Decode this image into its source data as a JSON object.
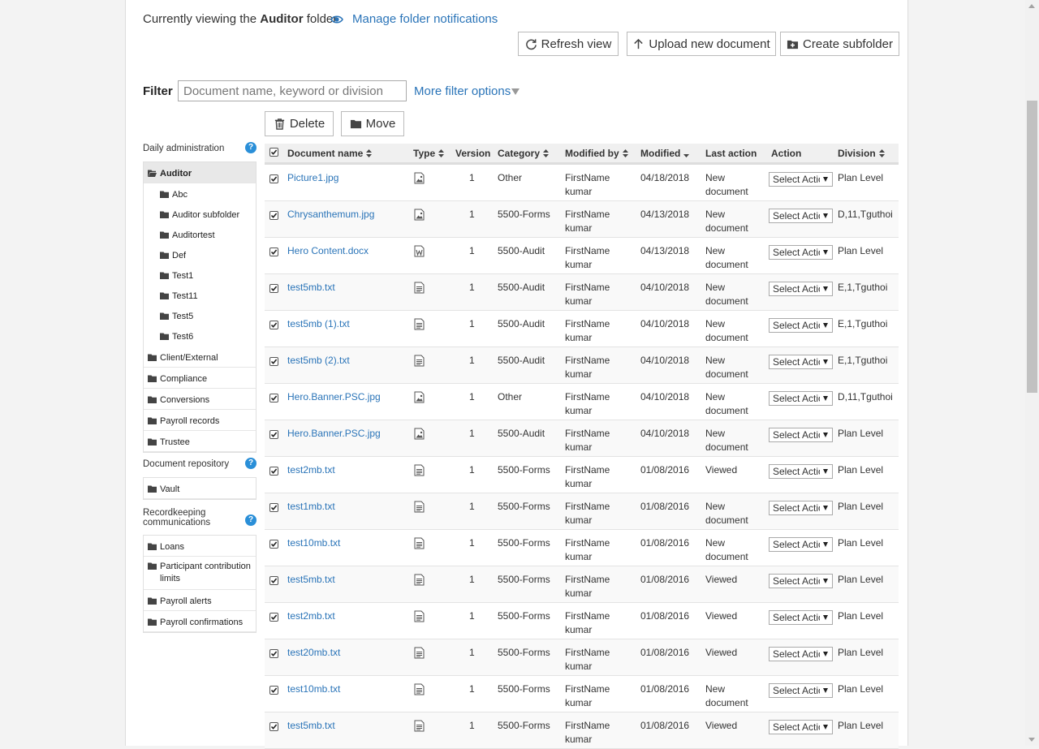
{
  "header": {
    "viewing_prefix": "Currently viewing the",
    "folder_name": "Auditor",
    "viewing_suffix": "folder",
    "manage_link": "Manage folder notifications"
  },
  "toolbar": {
    "refresh": "Refresh view",
    "upload": "Upload new document",
    "create_subfolder": "Create subfolder",
    "delete": "Delete",
    "move": "Move"
  },
  "filter": {
    "label": "Filter",
    "placeholder": "Document name, keyword or division",
    "more_options": "More filter options"
  },
  "sidebar": {
    "daily_admin": {
      "heading": "Daily administration",
      "items": [
        {
          "label": "Auditor",
          "active": true,
          "sub": false
        },
        {
          "label": "Abc",
          "sub": true
        },
        {
          "label": "Auditor subfolder",
          "sub": true
        },
        {
          "label": "Auditortest",
          "sub": true
        },
        {
          "label": "Def",
          "sub": true
        },
        {
          "label": "Test1",
          "sub": true
        },
        {
          "label": "Test11",
          "sub": true
        },
        {
          "label": "Test5",
          "sub": true
        },
        {
          "label": "Test6",
          "sub": true
        },
        {
          "label": "Client/External",
          "sub": false
        },
        {
          "label": "Compliance",
          "sub": false
        },
        {
          "label": "Conversions",
          "sub": false
        },
        {
          "label": "Payroll records",
          "sub": false
        },
        {
          "label": "Trustee",
          "sub": false
        }
      ]
    },
    "doc_repo": {
      "heading": "Document repository",
      "items": [
        {
          "label": "Vault"
        }
      ]
    },
    "recordkeeping": {
      "heading": "Recordkeeping communications",
      "items": [
        {
          "label": "Loans"
        },
        {
          "label": "Participant contribution limits"
        },
        {
          "label": "Payroll alerts"
        },
        {
          "label": "Payroll confirmations"
        }
      ]
    },
    "help_glyph": "?"
  },
  "table": {
    "columns": {
      "name": "Document name",
      "type": "Type",
      "version": "Version",
      "category": "Category",
      "modified_by": "Modified by",
      "modified": "Modified",
      "last_action": "Last action",
      "action": "Action",
      "division": "Division"
    },
    "select_placeholder": "Select Action",
    "rows": [
      {
        "name": "Picture1.jpg",
        "type": "image",
        "version": "1",
        "category": "Other",
        "by1": "FirstName",
        "by2": "kumar",
        "date": "04/18/2018",
        "act1": "New",
        "act2": "document",
        "division": "Plan Level"
      },
      {
        "name": "Chrysanthemum.jpg",
        "type": "image",
        "version": "1",
        "category": "5500-Forms",
        "by1": "FirstName",
        "by2": "kumar",
        "date": "04/13/2018",
        "act1": "New",
        "act2": "document",
        "division": "D,11,Tguthoi"
      },
      {
        "name": "Hero Content.docx",
        "type": "word",
        "version": "1",
        "category": "5500-Audit",
        "by1": "FirstName",
        "by2": "kumar",
        "date": "04/13/2018",
        "act1": "New",
        "act2": "document",
        "division": "Plan Level"
      },
      {
        "name": "test5mb.txt",
        "type": "text",
        "version": "1",
        "category": "5500-Audit",
        "by1": "FirstName",
        "by2": "kumar",
        "date": "04/10/2018",
        "act1": "New",
        "act2": "document",
        "division": "E,1,Tguthoi"
      },
      {
        "name": "test5mb (1).txt",
        "type": "text",
        "version": "1",
        "category": "5500-Audit",
        "by1": "FirstName",
        "by2": "kumar",
        "date": "04/10/2018",
        "act1": "New",
        "act2": "document",
        "division": "E,1,Tguthoi"
      },
      {
        "name": "test5mb (2).txt",
        "type": "text",
        "version": "1",
        "category": "5500-Audit",
        "by1": "FirstName",
        "by2": "kumar",
        "date": "04/10/2018",
        "act1": "New",
        "act2": "document",
        "division": "E,1,Tguthoi"
      },
      {
        "name": "Hero.Banner.PSC.jpg",
        "type": "image",
        "version": "1",
        "category": "Other",
        "by1": "FirstName",
        "by2": "kumar",
        "date": "04/10/2018",
        "act1": "New",
        "act2": "document",
        "division": "D,11,Tguthoi"
      },
      {
        "name": "Hero.Banner.PSC.jpg",
        "type": "image",
        "version": "1",
        "category": "5500-Audit",
        "by1": "FirstName",
        "by2": "kumar",
        "date": "04/10/2018",
        "act1": "New",
        "act2": "document",
        "division": "Plan Level"
      },
      {
        "name": "test2mb.txt",
        "type": "text",
        "version": "1",
        "category": "5500-Forms",
        "by1": "FirstName",
        "by2": "kumar",
        "date": "01/08/2016",
        "act1": "Viewed",
        "act2": "",
        "division": "Plan Level"
      },
      {
        "name": "test1mb.txt",
        "type": "text",
        "version": "1",
        "category": "5500-Forms",
        "by1": "FirstName",
        "by2": "kumar",
        "date": "01/08/2016",
        "act1": "New",
        "act2": "document",
        "division": "Plan Level"
      },
      {
        "name": "test10mb.txt",
        "type": "text",
        "version": "1",
        "category": "5500-Forms",
        "by1": "FirstName",
        "by2": "kumar",
        "date": "01/08/2016",
        "act1": "New",
        "act2": "document",
        "division": "Plan Level"
      },
      {
        "name": "test5mb.txt",
        "type": "text",
        "version": "1",
        "category": "5500-Forms",
        "by1": "FirstName",
        "by2": "kumar",
        "date": "01/08/2016",
        "act1": "Viewed",
        "act2": "",
        "division": "Plan Level"
      },
      {
        "name": "test2mb.txt",
        "type": "text",
        "version": "1",
        "category": "5500-Forms",
        "by1": "FirstName",
        "by2": "kumar",
        "date": "01/08/2016",
        "act1": "Viewed",
        "act2": "",
        "division": "Plan Level"
      },
      {
        "name": "test20mb.txt",
        "type": "text",
        "version": "1",
        "category": "5500-Forms",
        "by1": "FirstName",
        "by2": "kumar",
        "date": "01/08/2016",
        "act1": "Viewed",
        "act2": "",
        "division": "Plan Level"
      },
      {
        "name": "test10mb.txt",
        "type": "text",
        "version": "1",
        "category": "5500-Forms",
        "by1": "FirstName",
        "by2": "kumar",
        "date": "01/08/2016",
        "act1": "New",
        "act2": "document",
        "division": "Plan Level"
      },
      {
        "name": "test5mb.txt",
        "type": "text",
        "version": "1",
        "category": "5500-Forms",
        "by1": "FirstName",
        "by2": "kumar",
        "date": "01/08/2016",
        "act1": "Viewed",
        "act2": "",
        "division": "Plan Level"
      }
    ]
  },
  "colors": {
    "link": "#2a74b8",
    "help": "#2a8fd8"
  }
}
